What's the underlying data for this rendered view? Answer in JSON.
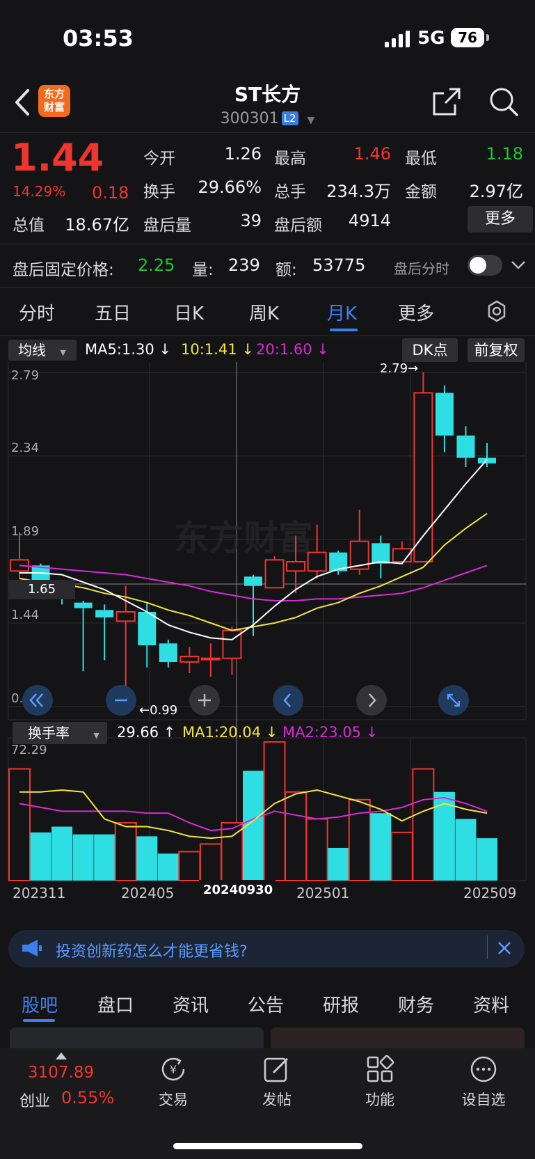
{
  "status": {
    "time": "03:53",
    "network": "5G",
    "battery": "76"
  },
  "header": {
    "name": "ST长方",
    "code": "300301",
    "badge": "L2",
    "logo_line1": "东方",
    "logo_line2": "财富"
  },
  "quote": {
    "price": "1.44",
    "change_pct": "14.29%",
    "change": "0.18",
    "open_label": "今开",
    "open": "1.26",
    "high_label": "最高",
    "high": "1.46",
    "low_label": "最低",
    "low": "1.18",
    "turnover_label": "换手",
    "turnover": "29.66%",
    "volume_label": "总手",
    "volume": "234.3万",
    "amount_label": "金额",
    "amount": "2.97亿",
    "mktcap_label": "总值",
    "mktcap": "18.67亿",
    "ah_vol_label": "盘后量",
    "ah_vol": "39",
    "ah_amt_label": "盘后额",
    "ah_amt": "4914",
    "more": "更多"
  },
  "after_hours": {
    "label": "盘后固定价格:",
    "price": "2.25",
    "vol_label": "量:",
    "vol": "239",
    "amt_label": "额:",
    "amt": "53775",
    "toggle_label": "盘后分时"
  },
  "tabs": [
    "分时",
    "五日",
    "日K",
    "周K",
    "月K",
    "更多"
  ],
  "indicators": {
    "ma_selector": "均线",
    "ma5": "MA5:1.30",
    "ma10": "10:1.41",
    "ma20": "20:1.60",
    "dk": "DK点",
    "fq": "前复权",
    "vol_selector": "换手率",
    "vol_now": "29.66",
    "vol_ma1": "MA1:20.04",
    "vol_ma2": "MA2:23.05"
  },
  "colors": {
    "up": "#f0352f",
    "down": "#2ddfe3",
    "ma5": "#ffffff",
    "ma10": "#f5e53a",
    "ma20": "#d62bd6",
    "accent": "#3e7ff0"
  },
  "chart_data": {
    "type": "candlestick",
    "y_ticks": [
      "2.79",
      "2.34",
      "1.89",
      "1.44",
      "0.99"
    ],
    "ylim": [
      0.99,
      2.79
    ],
    "x_labels": [
      "202311",
      "202405",
      "202501",
      "202509"
    ],
    "crosshair_date": "20240930",
    "crosshair_price": "1.65",
    "max_label": "2.79→",
    "min_label": "←0.99",
    "candles": [
      {
        "o": 1.72,
        "c": 1.78,
        "h": 1.93,
        "l": 1.68
      },
      {
        "o": 1.75,
        "c": 1.67,
        "h": 1.76,
        "l": 1.63
      },
      {
        "o": 1.66,
        "c": 1.58,
        "h": 1.67,
        "l": 1.54
      },
      {
        "o": 1.55,
        "c": 1.52,
        "h": 1.56,
        "l": 1.18
      },
      {
        "o": 1.51,
        "c": 1.47,
        "h": 1.54,
        "l": 1.24
      },
      {
        "o": 1.45,
        "c": 1.5,
        "h": 1.64,
        "l": 0.99
      },
      {
        "o": 1.5,
        "c": 1.32,
        "h": 1.55,
        "l": 1.2
      },
      {
        "o": 1.33,
        "c": 1.23,
        "h": 1.35,
        "l": 1.2
      },
      {
        "o": 1.23,
        "c": 1.26,
        "h": 1.31,
        "l": 1.17
      },
      {
        "o": 1.25,
        "c": 1.25,
        "h": 1.33,
        "l": 1.15
      },
      {
        "o": 1.25,
        "c": 1.4,
        "h": 1.42,
        "l": 1.16
      },
      {
        "o": 1.69,
        "c": 1.64,
        "h": 1.7,
        "l": 1.37
      },
      {
        "o": 1.63,
        "c": 1.78,
        "h": 1.8,
        "l": 1.63
      },
      {
        "o": 1.72,
        "c": 1.77,
        "h": 1.91,
        "l": 1.6
      },
      {
        "o": 1.72,
        "c": 1.82,
        "h": 1.97,
        "l": 1.68
      },
      {
        "o": 1.82,
        "c": 1.72,
        "h": 1.83,
        "l": 1.7
      },
      {
        "o": 1.73,
        "c": 1.88,
        "h": 2.05,
        "l": 1.7
      },
      {
        "o": 1.87,
        "c": 1.76,
        "h": 1.91,
        "l": 1.68
      },
      {
        "o": 1.77,
        "c": 1.84,
        "h": 1.88,
        "l": 1.76
      },
      {
        "o": 1.77,
        "c": 2.68,
        "h": 2.79,
        "l": 1.77
      },
      {
        "o": 2.68,
        "c": 2.45,
        "h": 2.72,
        "l": 2.36
      },
      {
        "o": 2.45,
        "c": 2.33,
        "h": 2.5,
        "l": 2.28
      },
      {
        "o": 2.33,
        "c": 2.3,
        "h": 2.41,
        "l": 2.28
      }
    ],
    "ma5": [
      1.71,
      1.71,
      1.7,
      1.66,
      1.62,
      1.56,
      1.5,
      1.43,
      1.39,
      1.36,
      1.35,
      1.43,
      1.53,
      1.62,
      1.69,
      1.73,
      1.75,
      1.77,
      1.76,
      1.91,
      2.05,
      2.19,
      2.32
    ],
    "ma10": [
      1.68,
      1.66,
      1.65,
      1.63,
      1.6,
      1.58,
      1.55,
      1.51,
      1.48,
      1.44,
      1.4,
      1.42,
      1.44,
      1.47,
      1.52,
      1.55,
      1.6,
      1.64,
      1.69,
      1.74,
      1.86,
      1.95,
      2.03
    ],
    "ma20": [
      1.75,
      1.74,
      1.73,
      1.72,
      1.71,
      1.7,
      1.68,
      1.66,
      1.64,
      1.61,
      1.59,
      1.57,
      1.56,
      1.56,
      1.57,
      1.57,
      1.58,
      1.59,
      1.6,
      1.63,
      1.67,
      1.71,
      1.75
    ],
    "vol_max_label": "72.29",
    "vol_max": 72.29,
    "volumes": [
      58,
      25,
      28,
      24,
      24,
      30,
      23,
      14,
      15,
      19,
      30,
      57,
      72,
      46,
      32,
      17,
      42,
      35,
      25,
      58,
      46,
      32,
      22
    ],
    "vol_ma1": [
      46,
      46,
      47,
      46,
      32,
      28,
      28,
      26,
      23,
      22,
      23,
      31,
      40,
      45,
      47,
      44,
      41,
      37,
      31,
      36,
      40,
      37,
      35
    ],
    "vol_ma2": [
      40,
      38,
      36,
      36,
      36,
      36,
      35,
      35,
      30,
      26,
      27,
      32,
      36,
      34,
      32,
      33,
      35,
      36,
      38,
      42,
      43,
      40,
      36
    ]
  },
  "promo": "投资创新药怎么才能更省钱?",
  "bottom_tabs": [
    "股吧",
    "盘口",
    "资讯",
    "公告",
    "研报",
    "财务",
    "资料"
  ],
  "nav": {
    "index_value": "3107.89",
    "index_name": "创业",
    "index_chg": "0.55%",
    "items": [
      "交易",
      "发帖",
      "功能",
      "设自选"
    ]
  }
}
